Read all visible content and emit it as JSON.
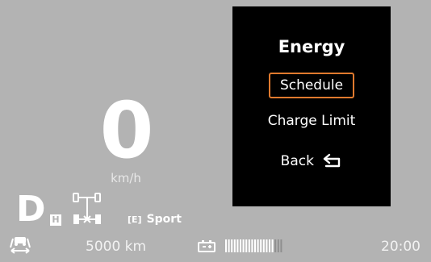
{
  "dashboard": {
    "speed_value": "0",
    "speed_unit": "km/h",
    "gear": "D",
    "drive_mode_badge": "H",
    "eco_mode_icon": "[E]",
    "eco_mode_label": "Sport"
  },
  "status_bar": {
    "odometer": "5000 km",
    "clock": "20:00",
    "battery_level_fraction": 0.85
  },
  "menu": {
    "title": "Energy",
    "items": [
      {
        "label": "Schedule",
        "selected": true
      },
      {
        "label": "Charge Limit",
        "selected": false
      },
      {
        "label": "Back",
        "selected": false
      }
    ]
  },
  "icons": {
    "drivetrain": "drivetrain-icon",
    "lane_assist": "lane-assist-icon",
    "battery": "battery-icon",
    "back": "back-arrow-icon"
  },
  "colors": {
    "screen_background": "#b3b3b3",
    "menu_background": "#000000",
    "selection_border": "#e07a2e",
    "text": "#ffffff"
  }
}
